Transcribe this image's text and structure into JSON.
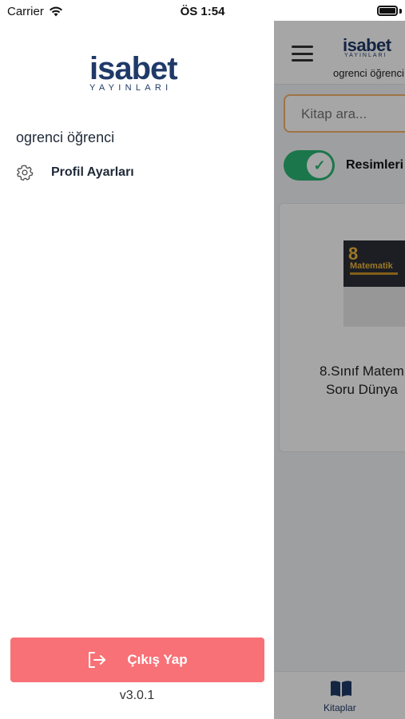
{
  "status_bar": {
    "carrier": "Carrier",
    "time": "ÖS 1:54"
  },
  "drawer": {
    "logo_main": "isabet",
    "logo_sub": "YAYINLARI",
    "user_name": "ogrenci öğrenci",
    "menu": [
      {
        "label": "Profil Ayarları",
        "icon": "gear-icon"
      }
    ],
    "logout_label": "Çıkış Yap",
    "logout_icon": "logout-icon",
    "logout_color": "#f87176",
    "version": "v3.0.1"
  },
  "background_app": {
    "header_logo_main": "isabet",
    "header_logo_sub": "YAYINLARI",
    "header_user": "ogrenci öğrenci",
    "search_placeholder": "Kitap ara...",
    "toggle_label": "Resimleri",
    "toggle_on": true,
    "book": {
      "cover_number": "8",
      "cover_title": "Matematik",
      "title_line1": "8.Sınıf Matem",
      "title_line2": "Soru Dünya"
    },
    "tab_label": "Kitaplar",
    "accent_color": "#1f3a68",
    "toggle_color": "#2bb673",
    "search_border_color": "#f5b26b"
  }
}
